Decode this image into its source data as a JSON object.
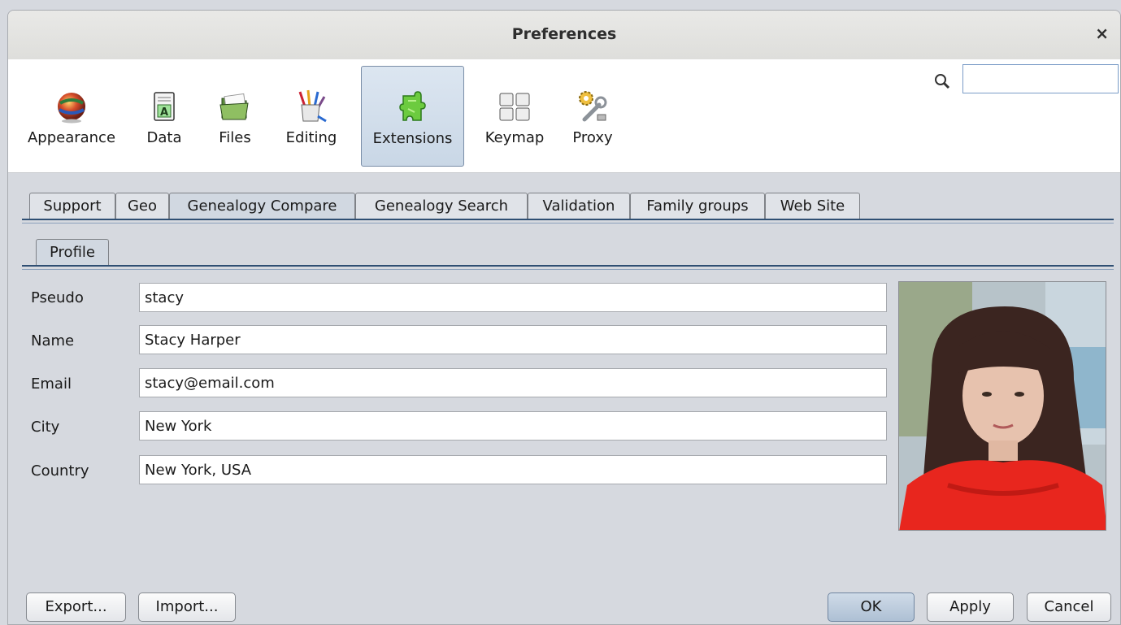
{
  "window": {
    "title": "Preferences",
    "close_glyph": "×"
  },
  "toolbar": {
    "items": [
      {
        "label": "Appearance",
        "icon": "globe-icon"
      },
      {
        "label": "Data",
        "icon": "data-sheet-icon"
      },
      {
        "label": "Files",
        "icon": "folder-icon"
      },
      {
        "label": "Editing",
        "icon": "brushes-cup-icon"
      },
      {
        "label": "Extensions",
        "icon": "puzzle-icon",
        "selected": true
      },
      {
        "label": "Keymap",
        "icon": "keyboard-keys-icon"
      },
      {
        "label": "Proxy",
        "icon": "gear-wrench-icon"
      }
    ],
    "search": {
      "value": "",
      "icon": "search-icon"
    }
  },
  "tabs": [
    "Support",
    "Geo",
    "Genealogy Compare",
    "Genealogy Search",
    "Validation",
    "Family groups",
    "Web Site"
  ],
  "selected_tab": "Genealogy Compare",
  "subtab": "Profile",
  "profile": {
    "fields": [
      {
        "label": "Pseudo",
        "value": "stacy"
      },
      {
        "label": "Name",
        "value": "Stacy Harper"
      },
      {
        "label": "Email",
        "value": "stacy@email.com"
      },
      {
        "label": "City",
        "value": "New York"
      },
      {
        "label": "Country",
        "value": "New York, USA"
      }
    ]
  },
  "buttons": {
    "export": "Export...",
    "import": "Import...",
    "ok": "OK",
    "apply": "Apply",
    "cancel": "Cancel"
  },
  "colors": {
    "accent": "#2f4f73",
    "selected_tool": "#c9d7e6"
  }
}
